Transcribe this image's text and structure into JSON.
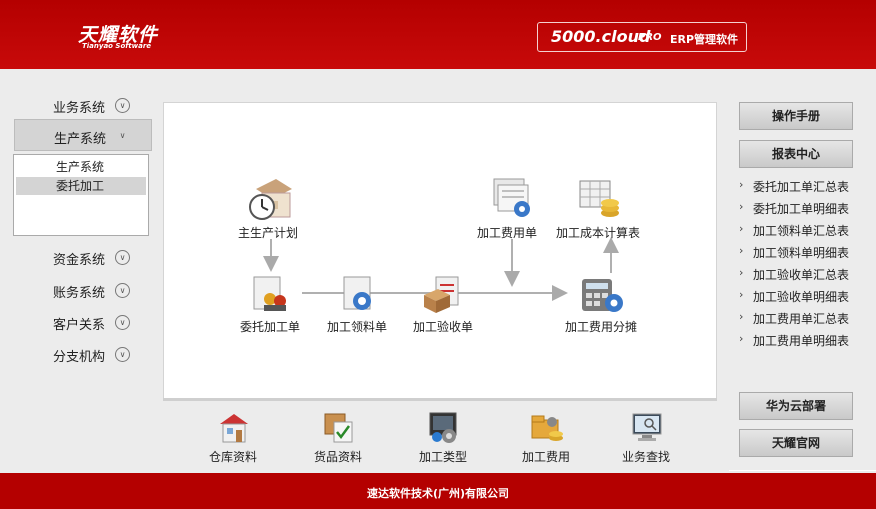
{
  "header": {
    "logo_text": "天耀软件",
    "logo_sub": "Tianyao Software",
    "product_name": "5000.cloud",
    "product_edition": "PRO",
    "product_desc": "ERP管理软件"
  },
  "sidebar": {
    "items": [
      {
        "label": "业务系统"
      },
      {
        "label": "生产系统"
      },
      {
        "label": "资金系统"
      },
      {
        "label": "账务系统"
      },
      {
        "label": "客户关系"
      },
      {
        "label": "分支机构"
      }
    ],
    "submenu": [
      {
        "label": "生产系统"
      },
      {
        "label": "委托加工"
      }
    ]
  },
  "flow": {
    "nodes": [
      {
        "label": "主生产计划"
      },
      {
        "label": "委托加工单"
      },
      {
        "label": "加工领料单"
      },
      {
        "label": "加工验收单"
      },
      {
        "label": "加工费用单"
      },
      {
        "label": "加工成本计算表"
      },
      {
        "label": "加工费用分摊"
      }
    ]
  },
  "tools": [
    {
      "label": "仓库资料"
    },
    {
      "label": "货品资料"
    },
    {
      "label": "加工类型"
    },
    {
      "label": "加工费用"
    },
    {
      "label": "业务查找"
    }
  ],
  "right": {
    "manual_button": "操作手册",
    "reports_button": "报表中心",
    "reports": [
      "委托加工单汇总表",
      "委托加工单明细表",
      "加工领料单汇总表",
      "加工领料单明细表",
      "加工验收单汇总表",
      "加工验收单明细表",
      "加工费用单汇总表",
      "加工费用单明细表"
    ],
    "huawei_button": "华为云部署",
    "official_button": "天耀官网"
  },
  "footer": {
    "company": "速达软件技术(广州)有限公司"
  },
  "colors": {
    "brand_red": "#b40000",
    "panel_bg": "#ffffff",
    "page_bg": "#ececec"
  }
}
